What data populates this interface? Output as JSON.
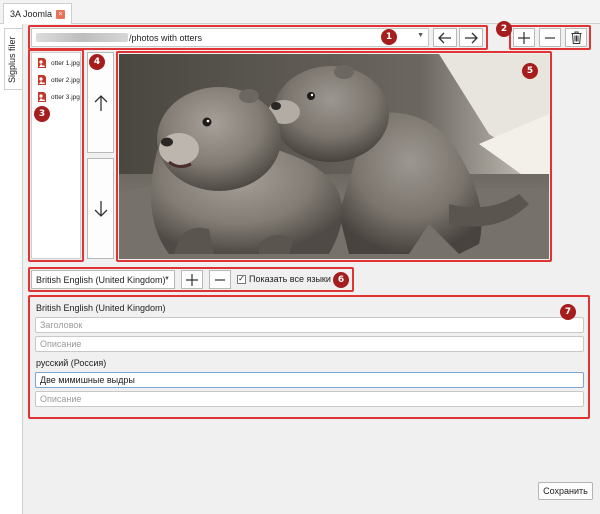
{
  "document_tab": {
    "label": "3A Joomla",
    "close": "×"
  },
  "side_tab": {
    "label": "Sigplus filer"
  },
  "path": {
    "blurred": "",
    "visible": "/photos with otters"
  },
  "nav": {
    "back_symbol": "←",
    "forward_symbol": "→"
  },
  "file_actions": {
    "add_symbol": "+",
    "remove_symbol": "−"
  },
  "files": [
    {
      "name": "otter 1.jpg"
    },
    {
      "name": "otter 2.jpg"
    },
    {
      "name": "otter 3.jpg"
    }
  ],
  "reorder": {
    "up_symbol": "↑",
    "down_symbol": "↓"
  },
  "language_bar": {
    "selected": "British English (United Kingdom)",
    "add_symbol": "+",
    "remove_symbol": "−",
    "show_all_label": "Показать все языки",
    "show_all_checked": true,
    "check_mark": "✓"
  },
  "languages": [
    {
      "name": "British English (United Kingdom)",
      "title_value": "",
      "title_placeholder": "Заголовок",
      "desc_value": "",
      "desc_placeholder": "Описание"
    },
    {
      "name": "русский (Россия)",
      "title_value": "Две мимишные выдры",
      "title_placeholder": "",
      "desc_value": "",
      "desc_placeholder": "Описание"
    }
  ],
  "save_label": "Сохранить",
  "callouts": [
    "1",
    "2",
    "3",
    "4",
    "5",
    "6",
    "7"
  ],
  "colors": {
    "callout": "#e03333",
    "badge": "#a51d1d",
    "tab_close": "#e8735a"
  }
}
